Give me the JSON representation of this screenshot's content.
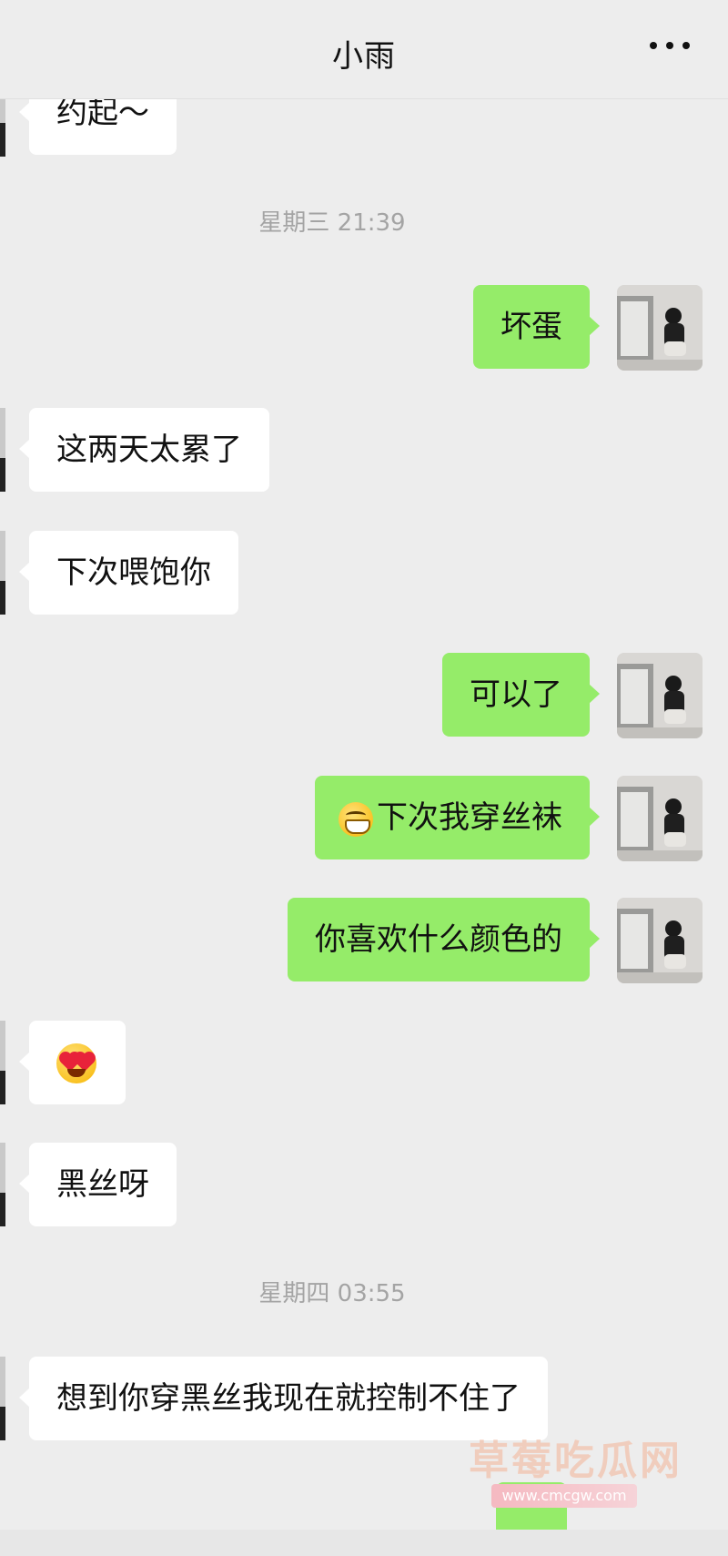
{
  "header": {
    "title": "小雨"
  },
  "timestamps": [
    "星期三 21:39",
    "星期四 03:55"
  ],
  "messages": [
    {
      "text": "约起～"
    },
    {
      "text": "坏蛋"
    },
    {
      "text": "这两天太累了"
    },
    {
      "text": "下次喂饱你"
    },
    {
      "text": "可以了"
    },
    {
      "text": "下次我穿丝袜"
    },
    {
      "text": "你喜欢什么颜色的"
    },
    {
      "text": "黑丝呀"
    },
    {
      "text": "想到你穿黑丝我现在就控制不住了"
    }
  ],
  "watermark": {
    "text": "草莓吃瓜网",
    "url": "www.cmcgw.com"
  },
  "icons": {
    "more": "more-icon",
    "avatar": "avatar-icon",
    "grin_emoji": "grinning-face-icon",
    "heart_eyes_emoji": "heart-eyes-face-icon"
  },
  "colors": {
    "incoming_bubble": "#ffffff",
    "outgoing_bubble": "#95ec69",
    "background": "#ededed"
  }
}
